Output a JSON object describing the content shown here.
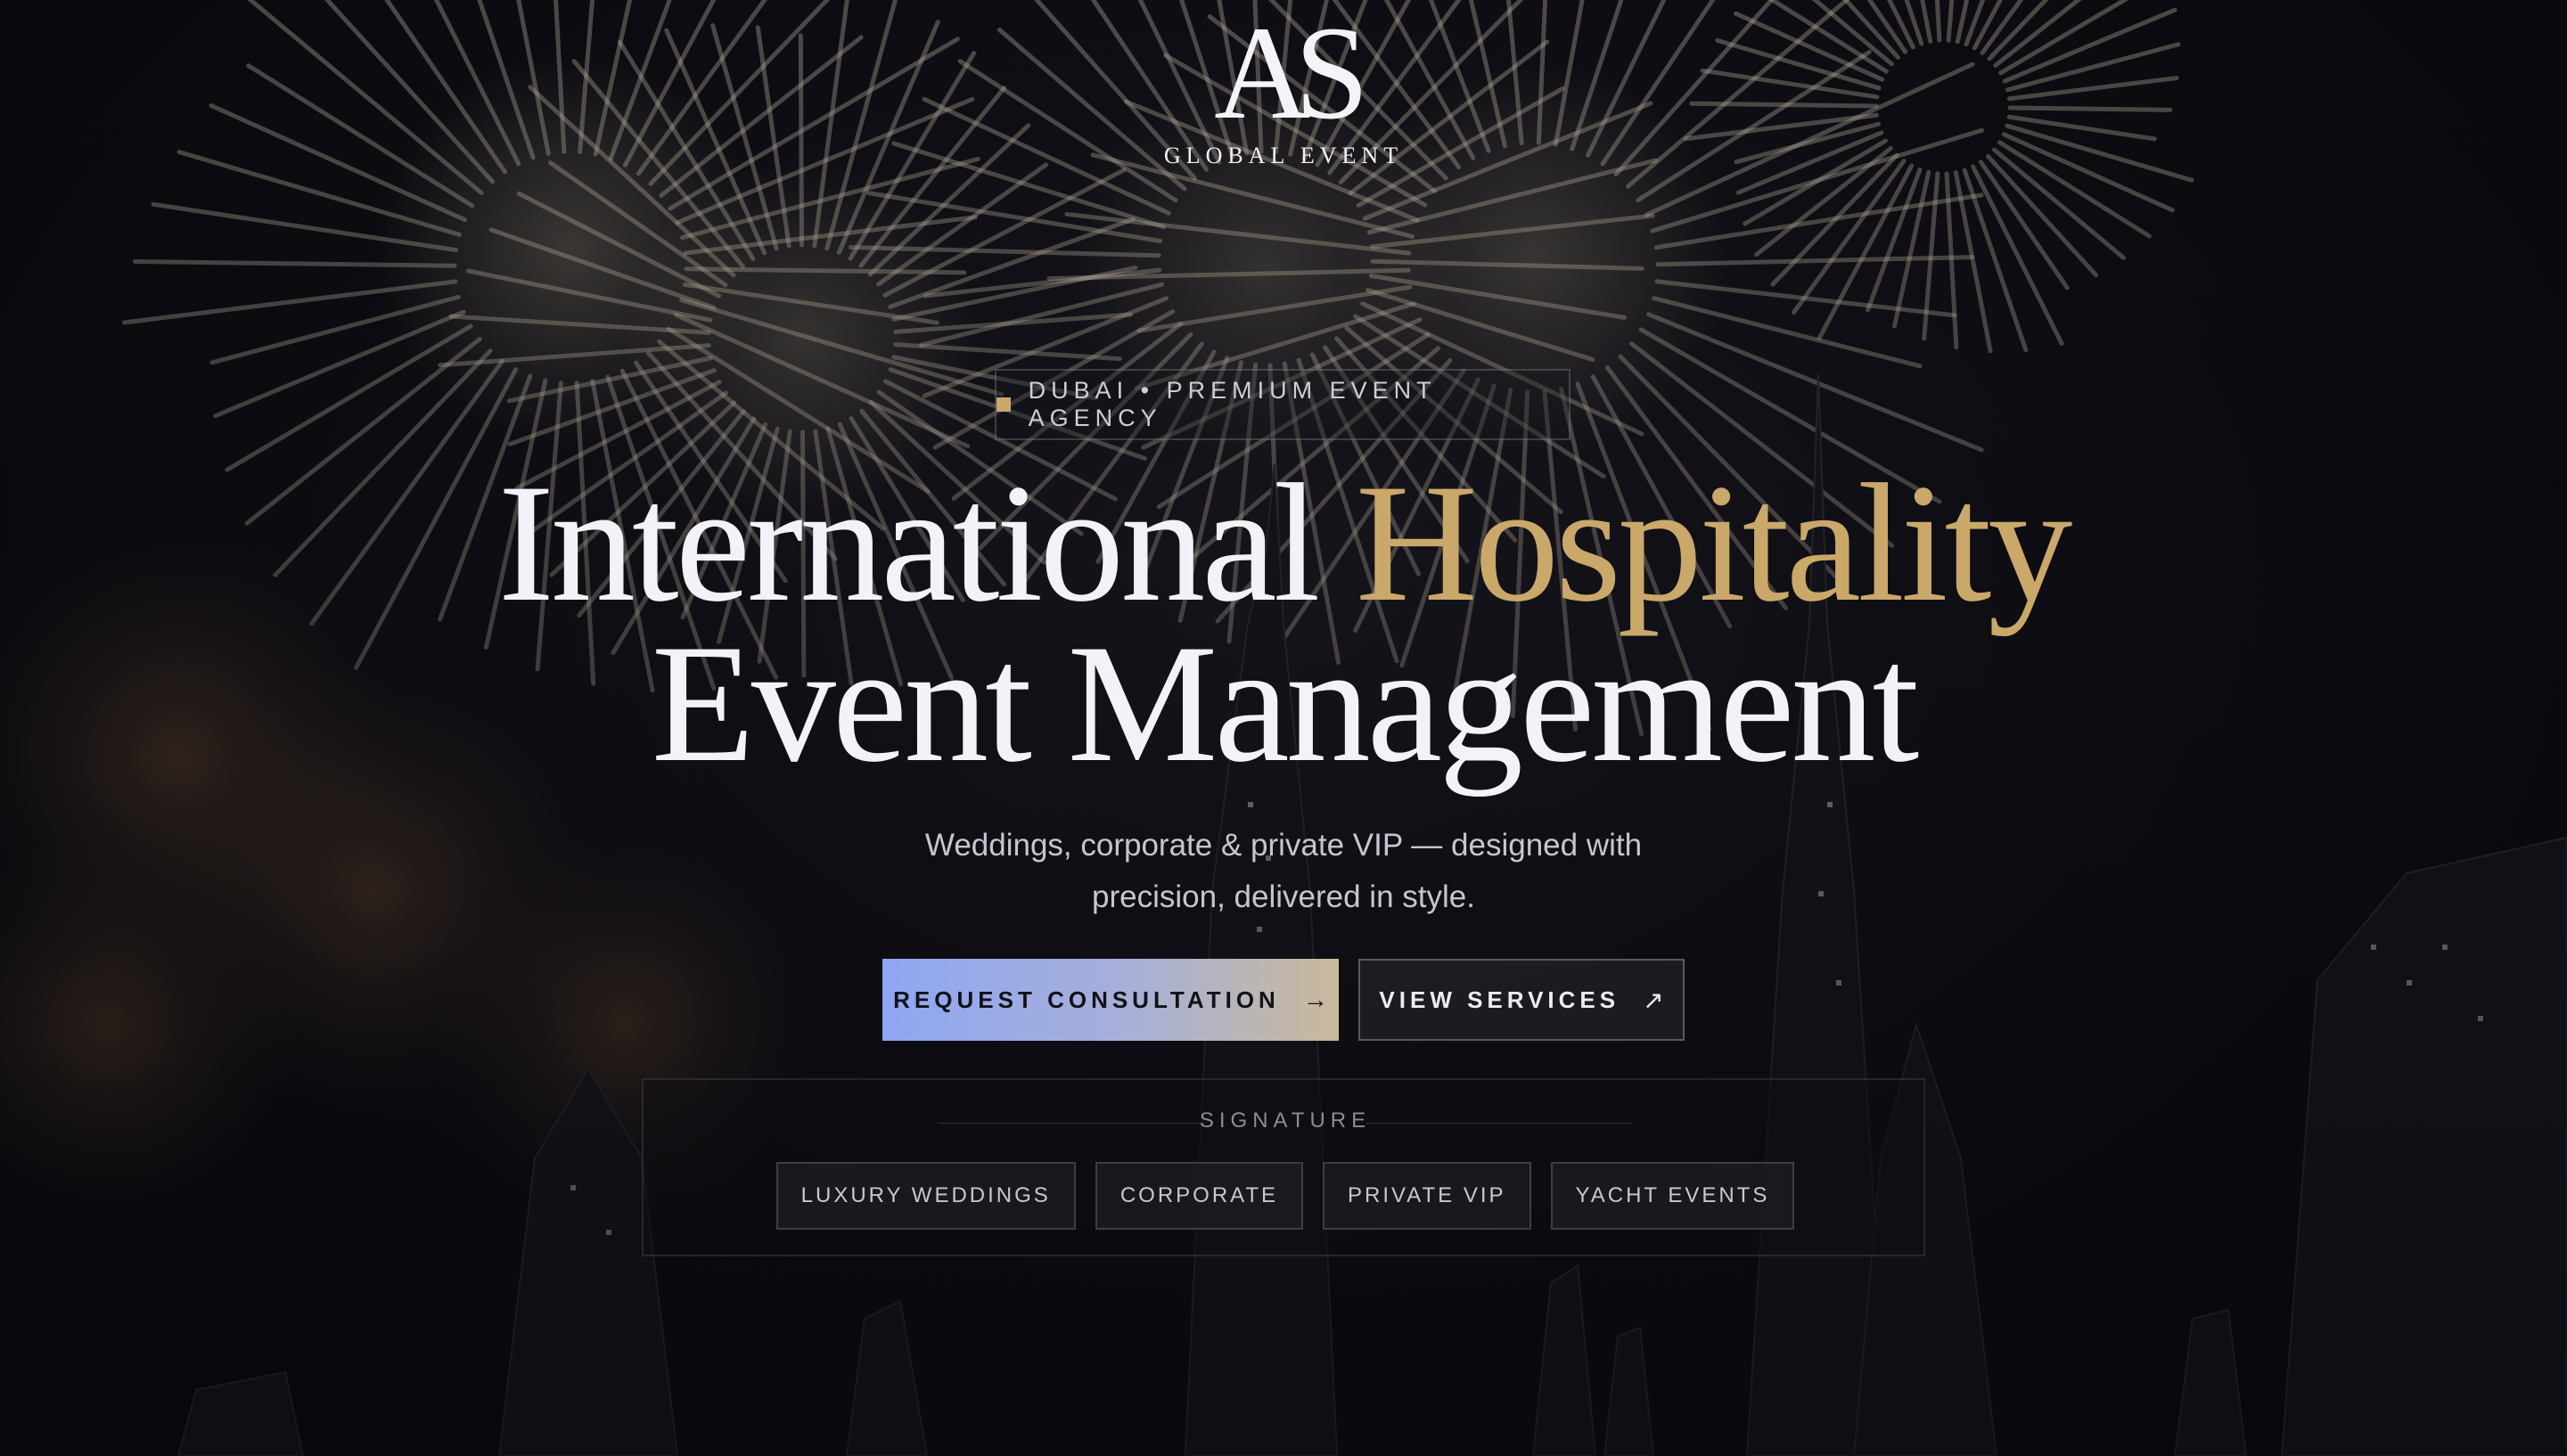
{
  "brand": {
    "monogram": "AS",
    "name": "GLOBAL EVENT"
  },
  "badge": {
    "text": "DUBAI • PREMIUM EVENT AGENCY"
  },
  "headline": {
    "line1_white": "International",
    "line1_gold": "Hospitality",
    "line2": "Event Management"
  },
  "subtitle": {
    "line1": "Weddings, corporate & private VIP — designed with",
    "line2": "precision, delivered in style."
  },
  "actions": {
    "primary_label": "REQUEST CONSULTATION",
    "primary_icon": "arrow-right-icon",
    "secondary_label": "VIEW SERVICES",
    "secondary_icon": "arrow-up-right-icon"
  },
  "signature": {
    "title": "SIGNATURE",
    "items": [
      "LUXURY WEDDINGS",
      "CORPORATE",
      "PRIVATE VIP",
      "YACHT EVENTS"
    ]
  },
  "colors": {
    "accent_gold": "#c9a86a",
    "primary_gradient_start": "#8fa6f2",
    "primary_gradient_end": "#c9b99a",
    "background": "#0b0b10"
  }
}
